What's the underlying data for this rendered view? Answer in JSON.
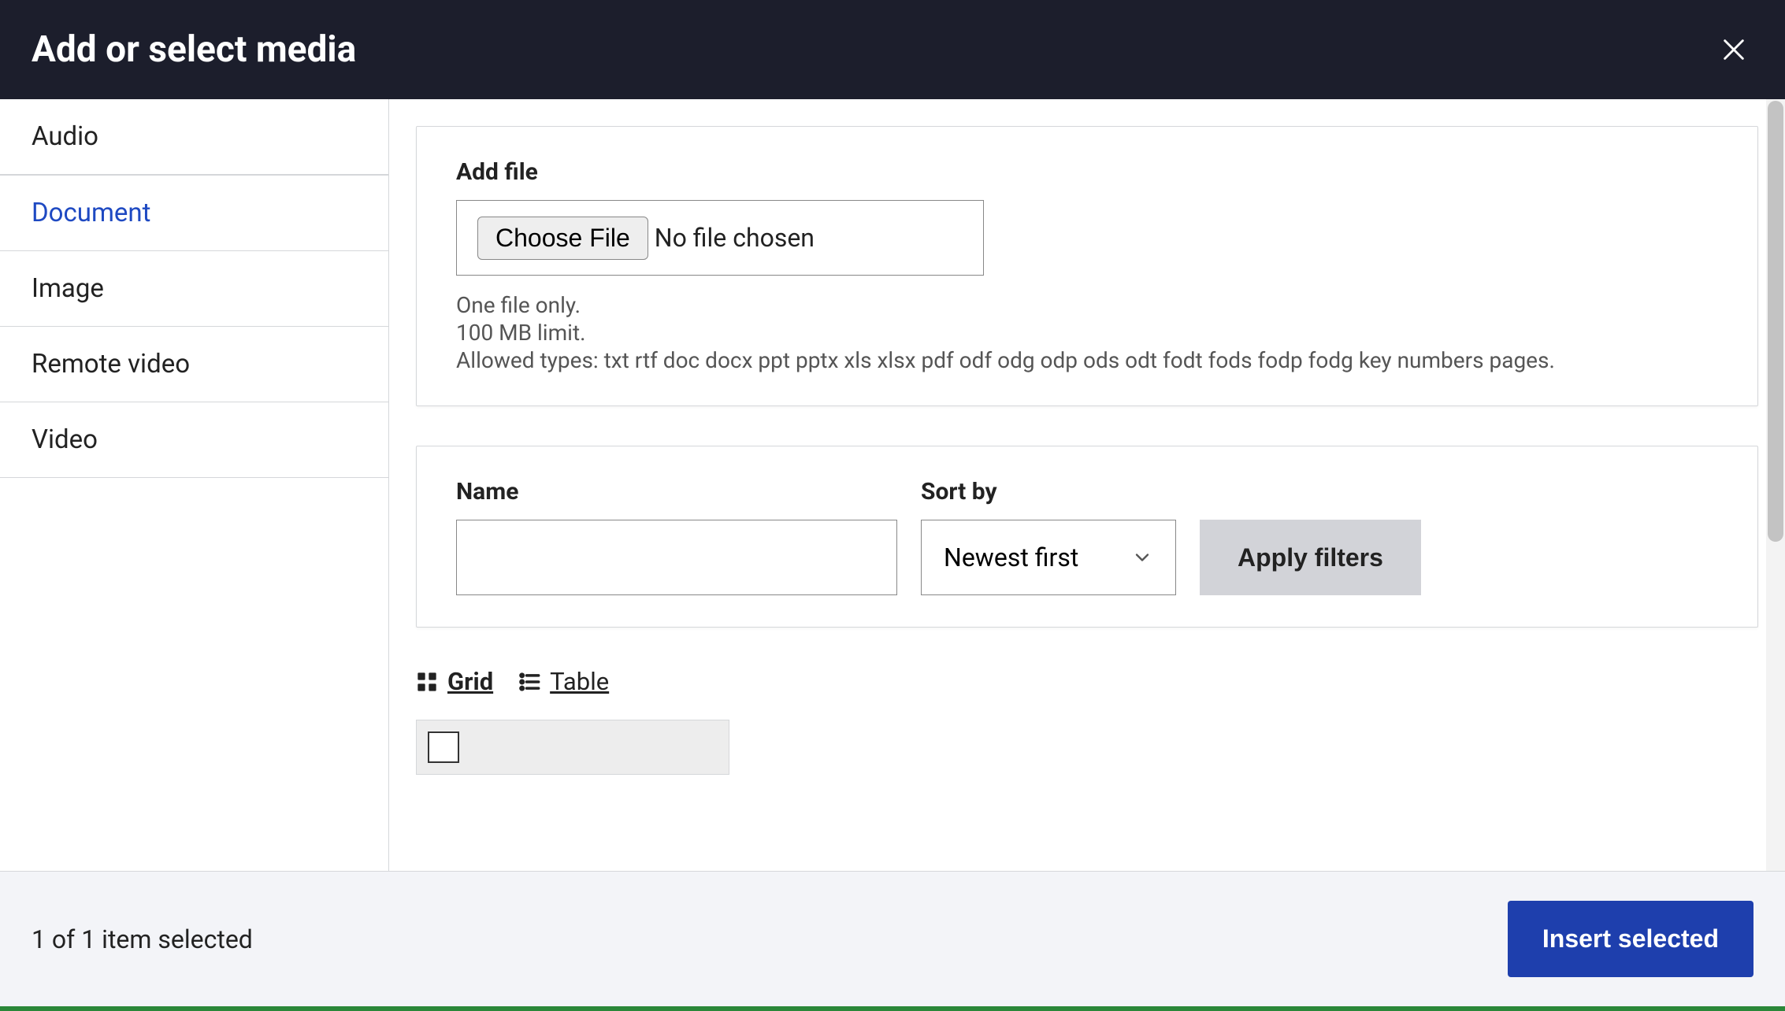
{
  "header": {
    "title": "Add or select media"
  },
  "sidebar": {
    "items": [
      {
        "label": "Audio",
        "active": false
      },
      {
        "label": "Document",
        "active": true
      },
      {
        "label": "Image",
        "active": false
      },
      {
        "label": "Remote video",
        "active": false
      },
      {
        "label": "Video",
        "active": false
      }
    ]
  },
  "upload": {
    "label": "Add file",
    "choose_button": "Choose File",
    "file_status": "No file chosen",
    "hint_line1": "One file only.",
    "hint_line2": "100 MB limit.",
    "hint_line3": "Allowed types: txt rtf doc docx ppt pptx xls xlsx pdf odf odg odp ods odt fodt fods fodp fodg key numbers pages."
  },
  "filters": {
    "name_label": "Name",
    "name_value": "",
    "sort_label": "Sort by",
    "sort_value": "Newest first",
    "apply_button": "Apply filters"
  },
  "views": {
    "grid": "Grid",
    "table": "Table"
  },
  "footer": {
    "status": "1 of 1 item selected",
    "insert_button": "Insert selected"
  }
}
